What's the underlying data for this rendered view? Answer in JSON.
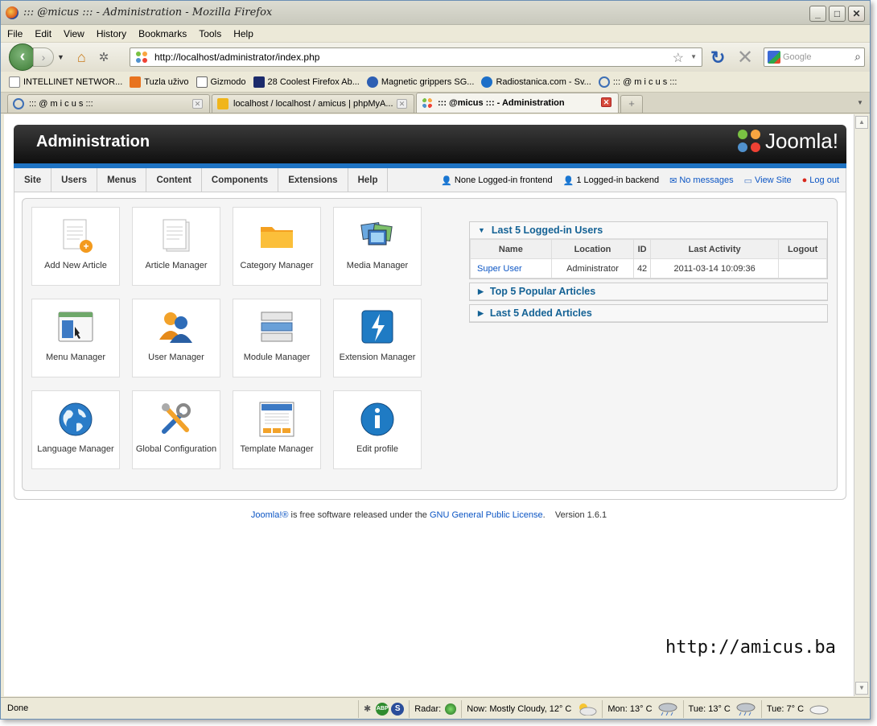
{
  "window": {
    "title": "::: @micus ::: - Administration - Mozilla Firefox"
  },
  "menubar": [
    "File",
    "Edit",
    "View",
    "History",
    "Bookmarks",
    "Tools",
    "Help"
  ],
  "navbar": {
    "url": "http://localhost/administrator/index.php",
    "search_placeholder": "Google"
  },
  "bookmarks": [
    {
      "label": "INTELLINET NETWOR...",
      "icon": "page-icon"
    },
    {
      "label": "Tuzla uživo",
      "icon": "tuzla-icon"
    },
    {
      "label": "Gizmodo",
      "icon": "gizmodo-icon"
    },
    {
      "label": "28 Coolest Firefox Ab...",
      "icon": "mte-icon"
    },
    {
      "label": "Magnetic grippers SG...",
      "icon": "magnetic-icon"
    },
    {
      "label": "Radiostanica.com - Sv...",
      "icon": "radio-icon"
    },
    {
      "label": "::: @ m i c u s :::",
      "icon": "amicus-icon"
    }
  ],
  "tabs": [
    {
      "label": "::: @ m i c u s :::",
      "active": false
    },
    {
      "label": "localhost / localhost / amicus | phpMyA...",
      "active": false
    },
    {
      "label": "::: @micus ::: - Administration",
      "active": true
    }
  ],
  "joomla": {
    "header_title": "Administration",
    "logo_text": "Joomla!",
    "menu": [
      "Site",
      "Users",
      "Menus",
      "Content",
      "Components",
      "Extensions",
      "Help"
    ],
    "status": {
      "frontend": "None Logged-in frontend",
      "backend": "1 Logged-in backend",
      "messages": "No messages",
      "view_site": "View Site",
      "logout": "Log out"
    },
    "quickicons": [
      {
        "label": "Add New Article",
        "icon": "add-article-icon"
      },
      {
        "label": "Article Manager",
        "icon": "article-manager-icon"
      },
      {
        "label": "Category Manager",
        "icon": "folder-icon"
      },
      {
        "label": "Media Manager",
        "icon": "media-icon"
      },
      {
        "label": "Menu Manager",
        "icon": "menu-manager-icon"
      },
      {
        "label": "User Manager",
        "icon": "users-icon"
      },
      {
        "label": "Module Manager",
        "icon": "module-icon"
      },
      {
        "label": "Extension Manager",
        "icon": "extension-icon"
      },
      {
        "label": "Language Manager",
        "icon": "globe-icon"
      },
      {
        "label": "Global Configuration",
        "icon": "tools-icon"
      },
      {
        "label": "Template Manager",
        "icon": "template-icon"
      },
      {
        "label": "Edit profile",
        "icon": "info-icon"
      }
    ],
    "modules": {
      "logged_in_title": "Last 5 Logged-in Users",
      "columns": [
        "Name",
        "Location",
        "ID",
        "Last Activity",
        "Logout"
      ],
      "rows": [
        {
          "name": "Super User",
          "location": "Administrator",
          "id": "42",
          "last_activity": "2011-03-14 10:09:36",
          "logout": ""
        }
      ],
      "popular_title": "Top 5 Popular Articles",
      "added_title": "Last 5 Added Articles"
    },
    "footer": {
      "joomla_link": "Joomla!®",
      "text1": " is free software released under the ",
      "license_link": "GNU General Public License",
      "text2": ".",
      "version": "Version 1.6.1"
    }
  },
  "watermark": "http://amicus.ba",
  "statusbar": {
    "done": "Done",
    "abp": "ABP",
    "s": "S",
    "radar": "Radar:",
    "now": "Now: Mostly Cloudy, 12° C",
    "mon": "Mon: 13° C",
    "tue1": "Tue: 13° C",
    "tue2": "Tue: 7° C"
  },
  "colors": {
    "joomla_blue": "#1e73c3",
    "link": "#0b55c4",
    "module_title": "#146295"
  }
}
